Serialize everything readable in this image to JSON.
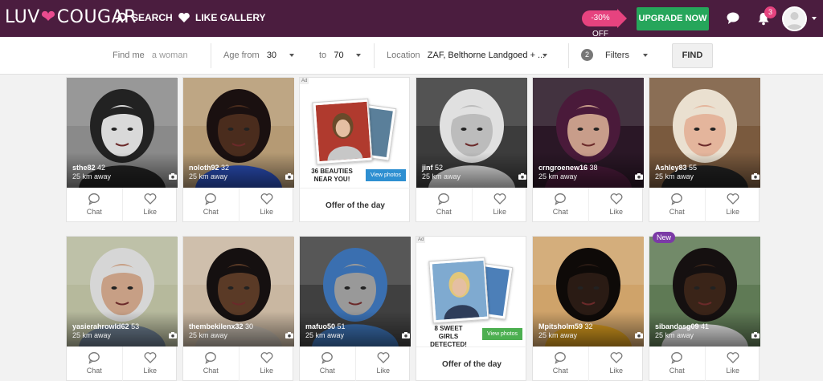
{
  "header": {
    "logo_left": "LUV",
    "logo_right": "COUGAR",
    "search_label": "SEARCH",
    "gallery_label": "LIKE GALLERY",
    "promo": "-30% OFF",
    "upgrade_label": "UPGRADE NOW",
    "notif_count": "3"
  },
  "filters": {
    "find_me_label": "Find me",
    "find_me_value": "a woman",
    "age_from_label": "Age from",
    "age_from_value": "30",
    "age_to_label": "to",
    "age_to_value": "70",
    "location_label": "Location",
    "location_value": "ZAF, Belthorne Landgoed + ...",
    "filters_count": "2",
    "filters_label": "Filters",
    "find_button": "FIND"
  },
  "actions": {
    "chat": "Chat",
    "like": "Like"
  },
  "profiles": [
    {
      "name": "sthe82",
      "age": "42",
      "distance": "25 km away",
      "photos": "1"
    },
    {
      "name": "noloth92",
      "age": "32",
      "distance": "25 km away",
      "photos": "1"
    },
    {
      "name": "jinf",
      "age": "52",
      "distance": "25 km away",
      "photos": "1"
    },
    {
      "name": "crngroenew16",
      "age": "38",
      "distance": "25 km away",
      "photos": "1"
    },
    {
      "name": "Ashley83",
      "age": "55",
      "distance": "25 km away",
      "photos": "1"
    },
    {
      "name": "yasierahrowld62",
      "age": "53",
      "distance": "25 km away",
      "photos": "1"
    },
    {
      "name": "thembekilenx32",
      "age": "30",
      "distance": "25 km away",
      "photos": "1"
    },
    {
      "name": "mafuo50",
      "age": "51",
      "distance": "25 km away",
      "photos": "1"
    },
    {
      "name": "Mpitsholm59",
      "age": "32",
      "distance": "25 km away",
      "photos": "1"
    },
    {
      "name": "sibandasg09",
      "age": "41",
      "distance": "25 km away",
      "photos": "1",
      "badge": "New"
    }
  ],
  "ads": [
    {
      "ad_tag": "Ad",
      "line1": "36 BEAUTIES",
      "line2": "NEAR YOU!",
      "button": "View photos",
      "offer": "Offer of the day",
      "button_color": "#2e8fd1"
    },
    {
      "ad_tag": "Ad",
      "line1": "8 SWEET GIRLS",
      "line2": "DETECTED!",
      "button": "View photos",
      "offer": "Offer of the day",
      "button_color": "#4caf50"
    }
  ],
  "colors": {
    "header_bg": "#4b1d3f",
    "accent_pink": "#e6437f",
    "upgrade_green": "#26a65b"
  }
}
